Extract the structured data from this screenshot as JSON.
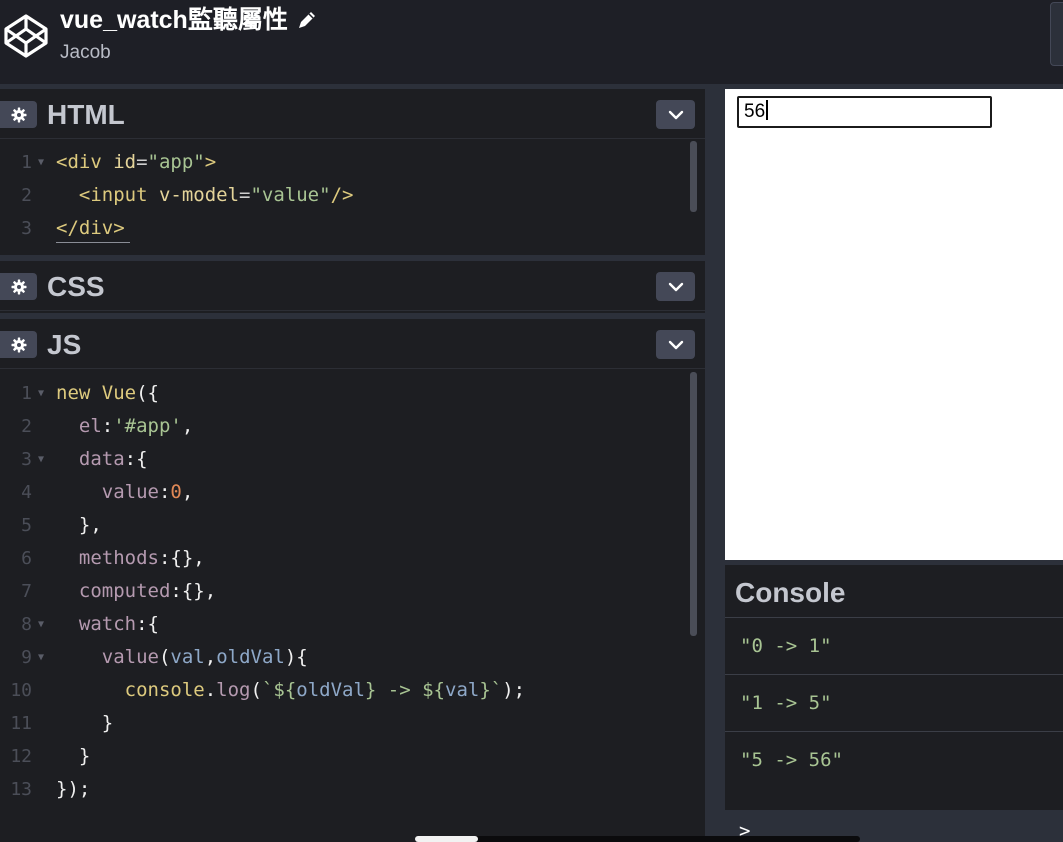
{
  "header": {
    "title": "vue_watch監聽屬性",
    "author": "Jacob",
    "logo_icon": "codepen-logo-icon",
    "edit_icon": "pencil-icon"
  },
  "panels": {
    "html": {
      "title": "HTML",
      "lines": [
        {
          "n": "1",
          "fold": true,
          "tokens": [
            [
              "t-tag",
              "<div "
            ],
            [
              "t-attr",
              "id"
            ],
            [
              "t-punc",
              "="
            ],
            [
              "t-str",
              "\"app\""
            ],
            [
              "t-tag",
              ">"
            ]
          ]
        },
        {
          "n": "2",
          "fold": false,
          "tokens": [
            [
              "t-tag",
              "  <input "
            ],
            [
              "t-attr",
              "v-model"
            ],
            [
              "t-punc",
              "="
            ],
            [
              "t-str",
              "\"value\""
            ],
            [
              "t-tag",
              "/>"
            ]
          ]
        },
        {
          "n": "3",
          "fold": false,
          "tokens": [
            [
              "t-tag",
              "</div>"
            ]
          ]
        }
      ]
    },
    "css": {
      "title": "CSS"
    },
    "js": {
      "title": "JS",
      "lines": [
        {
          "n": "1",
          "fold": true,
          "tokens": [
            [
              "t-kw",
              "new "
            ],
            [
              "t-kw",
              "Vue"
            ],
            [
              "t-wh",
              "({"
            ]
          ]
        },
        {
          "n": "2",
          "fold": false,
          "tokens": [
            [
              "t-prop",
              "  el"
            ],
            [
              "t-wh",
              ":"
            ],
            [
              "t-str",
              "'#app'"
            ],
            [
              "t-wh",
              ","
            ]
          ]
        },
        {
          "n": "3",
          "fold": true,
          "tokens": [
            [
              "t-prop",
              "  data"
            ],
            [
              "t-wh",
              ":{"
            ]
          ]
        },
        {
          "n": "4",
          "fold": false,
          "tokens": [
            [
              "t-prop",
              "    value"
            ],
            [
              "t-wh",
              ":"
            ],
            [
              "t-num",
              "0"
            ],
            [
              "t-wh",
              ","
            ]
          ]
        },
        {
          "n": "5",
          "fold": false,
          "tokens": [
            [
              "t-wh",
              "  },"
            ]
          ]
        },
        {
          "n": "6",
          "fold": false,
          "tokens": [
            [
              "t-prop",
              "  methods"
            ],
            [
              "t-wh",
              ":{},"
            ]
          ]
        },
        {
          "n": "7",
          "fold": false,
          "tokens": [
            [
              "t-prop",
              "  computed"
            ],
            [
              "t-wh",
              ":{},"
            ]
          ]
        },
        {
          "n": "8",
          "fold": true,
          "tokens": [
            [
              "t-prop",
              "  watch"
            ],
            [
              "t-wh",
              ":{"
            ]
          ]
        },
        {
          "n": "9",
          "fold": true,
          "tokens": [
            [
              "t-prop",
              "    value"
            ],
            [
              "t-wh",
              "("
            ],
            [
              "t-var",
              "val"
            ],
            [
              "t-wh",
              ","
            ],
            [
              "t-var",
              "oldVal"
            ],
            [
              "t-wh",
              "){"
            ]
          ]
        },
        {
          "n": "10",
          "fold": false,
          "tokens": [
            [
              "t-kw",
              "      console"
            ],
            [
              "t-wh",
              "."
            ],
            [
              "t-prop",
              "log"
            ],
            [
              "t-wh",
              "("
            ],
            [
              "t-str",
              "`${"
            ],
            [
              "t-var",
              "oldVal"
            ],
            [
              "t-str",
              "} -> ${"
            ],
            [
              "t-var",
              "val"
            ],
            [
              "t-str",
              "}`"
            ],
            [
              "t-wh",
              ");"
            ]
          ]
        },
        {
          "n": "11",
          "fold": false,
          "tokens": [
            [
              "t-wh",
              "    }"
            ]
          ]
        },
        {
          "n": "12",
          "fold": false,
          "tokens": [
            [
              "t-wh",
              "  }"
            ]
          ]
        },
        {
          "n": "13",
          "fold": false,
          "tokens": [
            [
              "t-wh",
              "});"
            ]
          ]
        }
      ]
    }
  },
  "preview": {
    "input_value": "56"
  },
  "console": {
    "title": "Console",
    "entries": [
      "\"0 -> 1\"",
      "\"1 -> 5\"",
      "\"5 -> 56\""
    ],
    "prompt": ">"
  },
  "colors": {
    "background": "#131417",
    "panel": "#1d1e22",
    "accent_string": "#a8c493",
    "tag": "#ddca7e"
  }
}
